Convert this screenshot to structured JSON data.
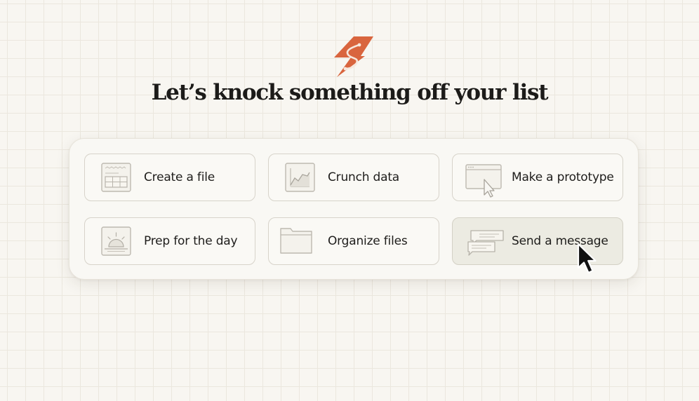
{
  "page": {
    "logo_icon": "lightning-bolt-logo",
    "headline": "Let’s knock something off your list",
    "accent_color": "#d9653e"
  },
  "actions": [
    {
      "label": "Create a file",
      "icon": "spreadsheet-file-icon"
    },
    {
      "label": "Crunch data",
      "icon": "chart-icon"
    },
    {
      "label": "Make a prototype",
      "icon": "browser-window-cursor-icon"
    },
    {
      "label": "Prep for the day",
      "icon": "sunrise-icon"
    },
    {
      "label": "Organize files",
      "icon": "folder-icon"
    },
    {
      "label": "Send a message",
      "icon": "chat-bubbles-icon",
      "selected": true
    }
  ],
  "pointer": {
    "icon": "mouse-pointer-icon"
  }
}
